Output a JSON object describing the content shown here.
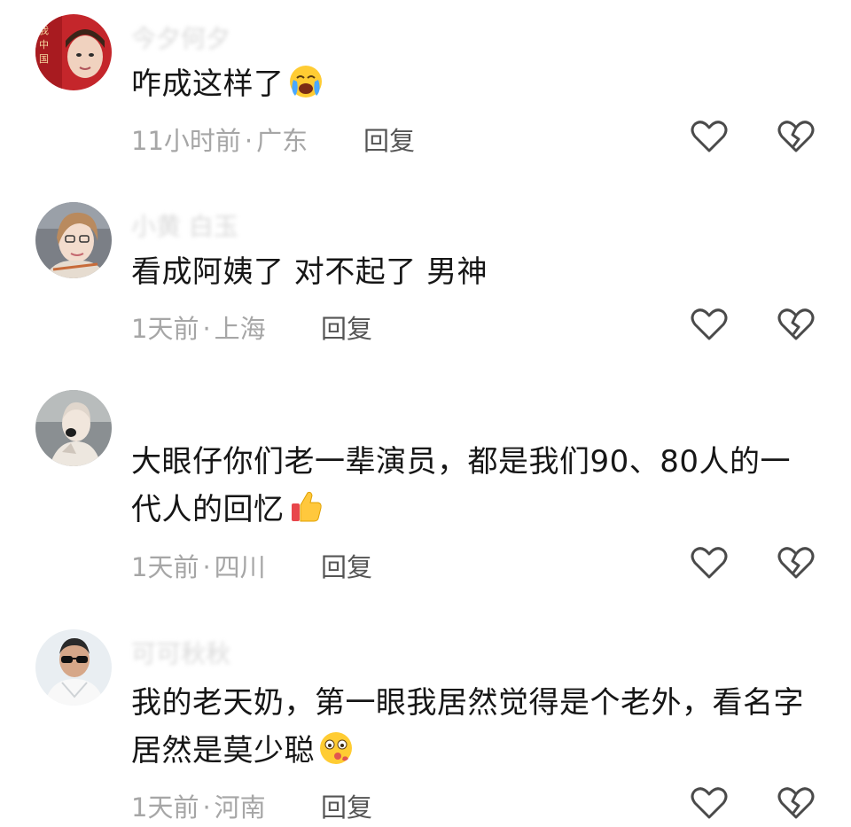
{
  "comments": [
    {
      "username": "今夕何夕",
      "text": "咋成这样了",
      "emoji": "crying-face-emoji",
      "time": "11小时前",
      "location": "广东",
      "reply_label": "回复"
    },
    {
      "username": "小黄 白玉",
      "text": "看成阿姨了 对不起了 男神",
      "emoji": "",
      "time": "1天前",
      "location": "上海",
      "reply_label": "回复"
    },
    {
      "username": "",
      "text": "大眼仔你们老一辈演员，都是我们90、80人的一代人的回忆",
      "emoji": "thumbs-up-emoji",
      "time": "1天前",
      "location": "四川",
      "reply_label": "回复"
    },
    {
      "username": "可可秋秋",
      "text": "我的老天奶，第一眼我居然觉得是个老外，看名字居然是莫少聪",
      "emoji": "surprised-face-emoji",
      "time": "1天前",
      "location": "河南",
      "reply_label": "回复"
    }
  ],
  "separator": "·",
  "icons": {
    "like": "heart-outline-icon",
    "dislike": "broken-heart-icon"
  },
  "colors": {
    "text": "#161616",
    "meta": "#a6a6a6",
    "reply": "#555555",
    "icon": "#4a4a4a"
  }
}
